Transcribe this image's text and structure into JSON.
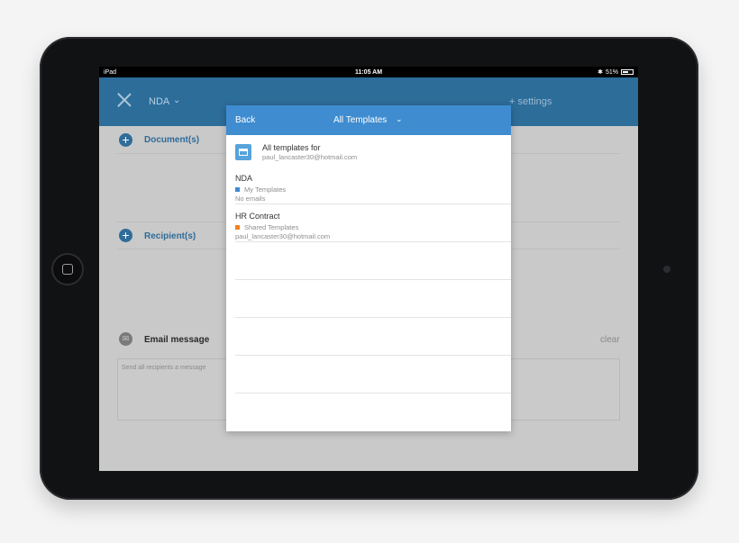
{
  "status_bar": {
    "device": "iPad",
    "time": "11:05 AM",
    "battery": "51%"
  },
  "app_header": {
    "document_title": "NDA",
    "settings_link": "+ settings"
  },
  "sections": {
    "documents_label": "Document(s)",
    "recipients_label": "Recipient(s)",
    "email_message_label": "Email message",
    "clear_label": "clear",
    "message_placeholder": "Send all recipients a message"
  },
  "modal": {
    "back_label": "Back",
    "title": "All Templates",
    "all_templates_row": {
      "title": "All templates for",
      "email": "paul_lancaster30@hotmail.com"
    },
    "templates": [
      {
        "name": "NDA",
        "folder": "My Templates",
        "folder_color": "#3f8cd0",
        "extra": "No emails"
      },
      {
        "name": "HR Contract",
        "folder": "Shared Templates",
        "folder_color": "#f0821e",
        "extra": "paul_lancaster30@hotmail.com"
      }
    ]
  },
  "colors": {
    "header_blue": "#2d6d9a",
    "modal_header_blue": "#3f8cd0",
    "accent_blue": "#2f6c99",
    "orange": "#f0821e"
  }
}
